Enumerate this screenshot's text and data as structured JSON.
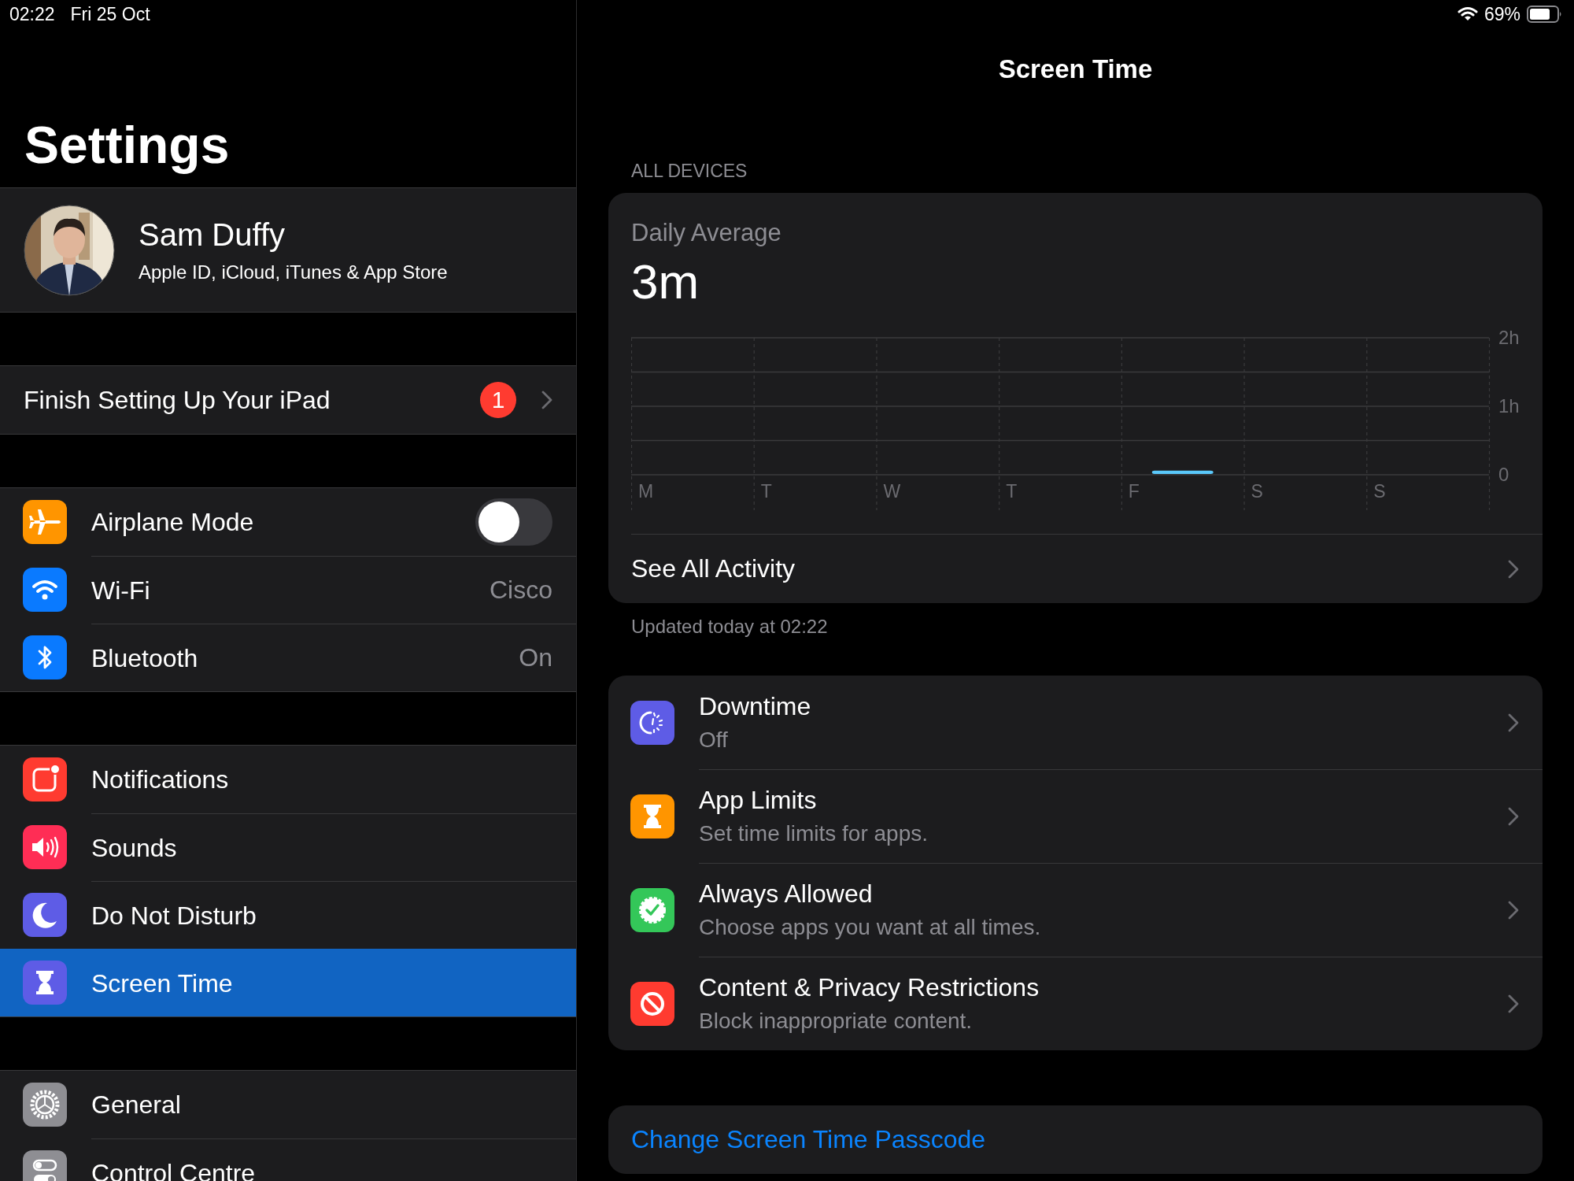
{
  "status_bar": {
    "time": "02:22",
    "date": "Fri 25 Oct",
    "battery": "69%"
  },
  "sidebar": {
    "title": "Settings",
    "profile": {
      "name": "Sam Duffy",
      "subtitle": "Apple ID, iCloud, iTunes & App Store"
    },
    "groups": [
      {
        "items": [
          {
            "kind": "badge",
            "label": "Finish Setting Up Your iPad",
            "badge": "1",
            "selected": false
          }
        ]
      },
      {
        "items": [
          {
            "kind": "toggle",
            "label": "Airplane Mode",
            "on": false,
            "selected": false
          },
          {
            "kind": "value",
            "label": "Wi-Fi",
            "value": "Cisco",
            "selected": false
          },
          {
            "kind": "value",
            "label": "Bluetooth",
            "value": "On",
            "selected": false
          }
        ]
      },
      {
        "items": [
          {
            "kind": "plain",
            "label": "Notifications",
            "selected": false
          },
          {
            "kind": "plain",
            "label": "Sounds",
            "selected": false
          },
          {
            "kind": "plain",
            "label": "Do Not Disturb",
            "selected": false
          },
          {
            "kind": "plain",
            "label": "Screen Time",
            "selected": true
          }
        ]
      },
      {
        "items": [
          {
            "kind": "plain",
            "label": "General",
            "selected": false
          },
          {
            "kind": "plain",
            "label": "Control Centre",
            "selected": false
          }
        ]
      }
    ]
  },
  "detail": {
    "title": "Screen Time",
    "section_header": "ALL DEVICES",
    "summary": {
      "label": "Daily Average",
      "value": "3m",
      "chart_data": {
        "type": "bar",
        "categories": [
          "M",
          "T",
          "W",
          "T",
          "F",
          "S",
          "S"
        ],
        "series": [
          {
            "color": "#5ac8fa",
            "values": [
              0,
              0,
              0,
              0,
              0.05,
              0,
              0
            ]
          }
        ],
        "ylim": [
          0,
          2
        ],
        "yticks": [
          {
            "value": 0,
            "label": "0"
          },
          {
            "value": 1,
            "label": "1h"
          },
          {
            "value": 2,
            "label": "2h"
          }
        ]
      },
      "link": "See All Activity"
    },
    "updated": "Updated today at 02:22",
    "options": [
      {
        "title": "Downtime",
        "subtitle": "Off"
      },
      {
        "title": "App Limits",
        "subtitle": "Set time limits for apps."
      },
      {
        "title": "Always Allowed",
        "subtitle": "Choose apps you want at all times."
      },
      {
        "title": "Content & Privacy Restrictions",
        "subtitle": "Block inappropriate content."
      }
    ],
    "passcode_link": "Change Screen Time Passcode"
  }
}
